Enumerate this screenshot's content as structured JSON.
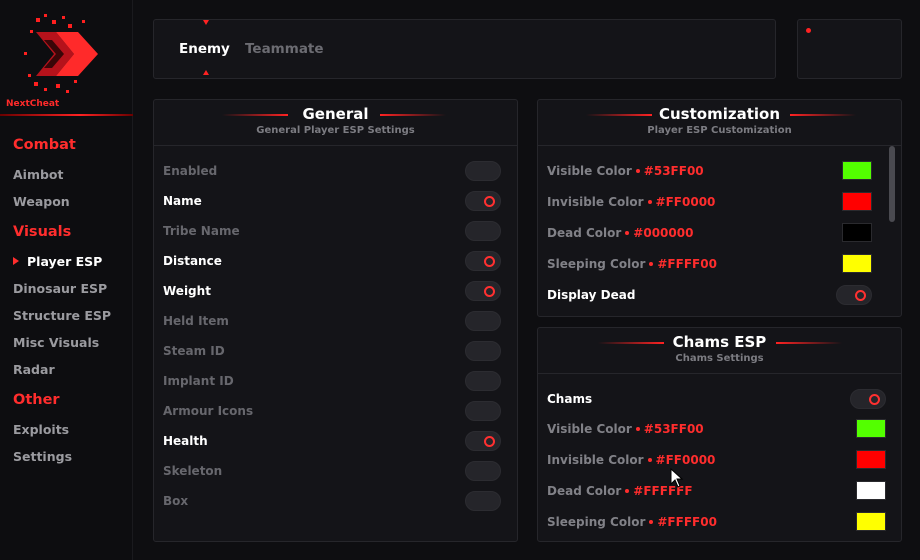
{
  "brand": {
    "name": "NextCheat",
    "accent": "#ff2a2a"
  },
  "sidebar": {
    "sections": [
      {
        "title": "Combat",
        "items": [
          {
            "label": "Aimbot"
          },
          {
            "label": "Weapon"
          }
        ]
      },
      {
        "title": "Visuals",
        "items": [
          {
            "label": "Player ESP",
            "active": true
          },
          {
            "label": "Dinosaur ESP"
          },
          {
            "label": "Structure ESP"
          },
          {
            "label": "Misc Visuals"
          },
          {
            "label": "Radar"
          }
        ]
      },
      {
        "title": "Other",
        "items": [
          {
            "label": "Exploits"
          },
          {
            "label": "Settings"
          }
        ]
      }
    ]
  },
  "tabs": [
    {
      "label": "Enemy",
      "active": true
    },
    {
      "label": "Teammate",
      "active": false
    }
  ],
  "general": {
    "title": "General",
    "subtitle": "General Player ESP Settings",
    "options": [
      {
        "label": "Enabled",
        "on": false
      },
      {
        "label": "Name",
        "on": true
      },
      {
        "label": "Tribe Name",
        "on": false
      },
      {
        "label": "Distance",
        "on": true
      },
      {
        "label": "Weight",
        "on": true
      },
      {
        "label": "Held Item",
        "on": false
      },
      {
        "label": "Steam ID",
        "on": false
      },
      {
        "label": "Implant ID",
        "on": false
      },
      {
        "label": "Armour Icons",
        "on": false
      },
      {
        "label": "Health",
        "on": true
      },
      {
        "label": "Skeleton",
        "on": false
      },
      {
        "label": "Box",
        "on": false
      }
    ]
  },
  "customization": {
    "title": "Customization",
    "subtitle": "Player ESP Customization",
    "colors": [
      {
        "label": "Visible Color",
        "hex": "#53FF00",
        "swatch": "#53ff00"
      },
      {
        "label": "Invisible Color",
        "hex": "#FF0000",
        "swatch": "#ff0000"
      },
      {
        "label": "Dead Color",
        "hex": "#000000",
        "swatch": "#000000"
      },
      {
        "label": "Sleeping Color",
        "hex": "#FFFF00",
        "swatch": "#ffff00"
      }
    ],
    "toggle": {
      "label": "Display Dead",
      "on": true
    }
  },
  "chams": {
    "title": "Chams ESP",
    "subtitle": "Chams Settings",
    "toggle": {
      "label": "Chams",
      "on": true
    },
    "colors": [
      {
        "label": "Visible Color",
        "hex": "#53FF00",
        "swatch": "#53ff00"
      },
      {
        "label": "Invisible Color",
        "hex": "#FF0000",
        "swatch": "#ff0000"
      },
      {
        "label": "Dead Color",
        "hex": "#FFFFFF",
        "swatch": "#ffffff"
      },
      {
        "label": "Sleeping Color",
        "hex": "#FFFF00",
        "swatch": "#ffff00"
      }
    ]
  }
}
